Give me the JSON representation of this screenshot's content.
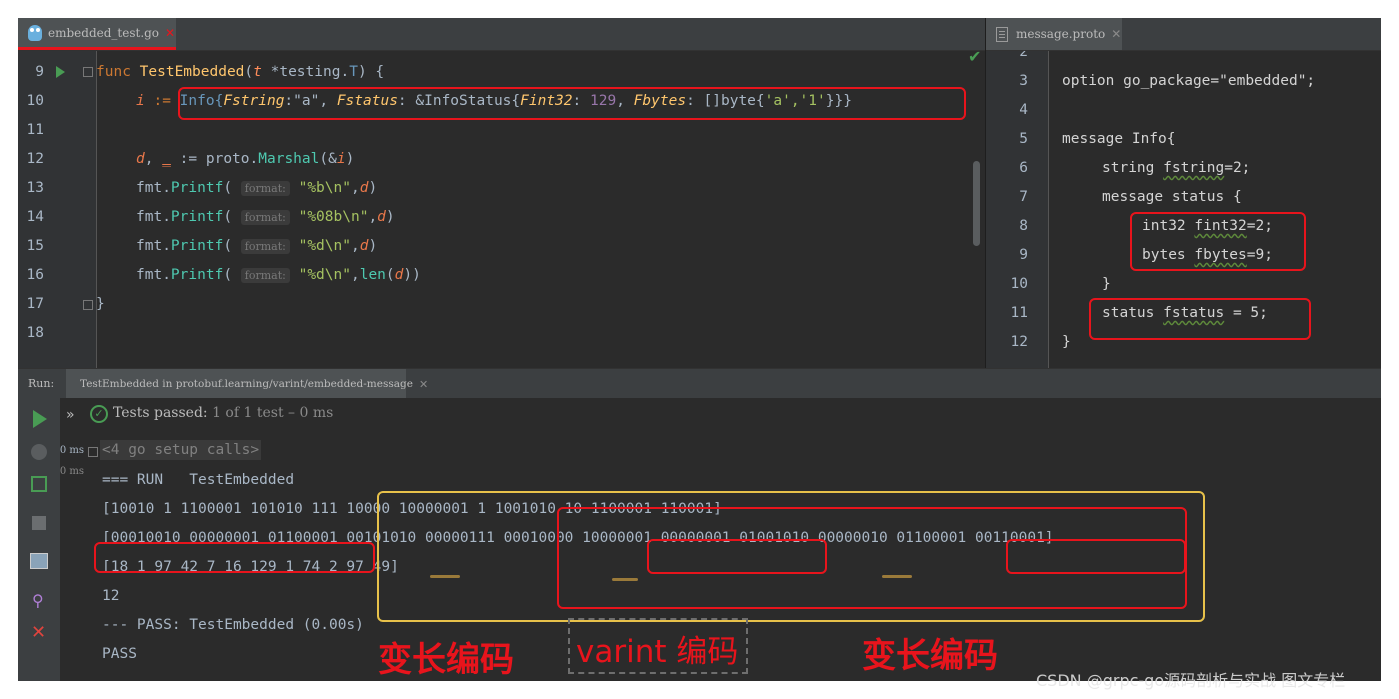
{
  "editor_left": {
    "tab_label": "embedded_test.go",
    "tab_icon": "gopher-icon",
    "lines": [
      "9",
      "10",
      "11",
      "12",
      "13",
      "14",
      "15",
      "16",
      "17",
      "18"
    ],
    "code": {
      "l9_func": "func",
      "l9_name": "TestEmbedded",
      "l9_param": "t",
      "l9_rest": " *testing.",
      "l9_T": "T",
      "l9_end": ") {",
      "l10_i": "i",
      "l10_assign": " := ",
      "l10_info": "Info{",
      "l10_fstring": "Fstring",
      "l10_a": ":\"a\", ",
      "l10_fstatus": "Fstatus",
      "l10_infostatus": ": &InfoStatus{",
      "l10_fint32": "Fint32",
      "l10_129pre": ": ",
      "l10_129": "129",
      "l10_comma": ", ",
      "l10_fbytes": "Fbytes",
      "l10_bytes": ": []byte{",
      "l10_chars": "'a','1'",
      "l10_end": "}}}",
      "l12_d": "d",
      "l12_comma": ", ",
      "l12_us": "_",
      "l12_assign": " := proto.",
      "l12_marshal": "Marshal",
      "l12_amp": "(&",
      "l12_i": "i",
      "l12_end": ")",
      "fmt": "fmt.",
      "printf": "Printf",
      "paren": "( ",
      "hint": "format:",
      "l13_fmt": "\"%b\\n\"",
      "l14_fmt": "\"%08b\\n\"",
      "l15_fmt": "\"%d\\n\"",
      "l16_fmt": "\"%d\\n\"",
      "comma": ",",
      "d": "d",
      "close": ")",
      "len": "len",
      "l16_end": "))",
      "l17": "}"
    }
  },
  "editor_right": {
    "tab_label": "message.proto",
    "lines": [
      "2",
      "3",
      "4",
      "5",
      "6",
      "7",
      "8",
      "9",
      "10",
      "11",
      "12"
    ],
    "code": {
      "l3": "option go_package=\"embedded\";",
      "l5": "message Info{",
      "l6_a": "string ",
      "l6_b": "fstring",
      "l6_c": "=2;",
      "l7": "message status {",
      "l8_a": "int32 ",
      "l8_b": "fint32",
      "l8_c": "=2;",
      "l9_a": "bytes ",
      "l9_b": "fbytes",
      "l9_c": "=9;",
      "l10": "}",
      "l11_a": "status ",
      "l11_b": "fstatus",
      "l11_c": " = 5;",
      "l12": "}"
    }
  },
  "run": {
    "label": "Run:",
    "tab": "TestEmbedded in protobuf.learning/varint/embedded-message",
    "tests_passed": "Tests passed:",
    "count": " 1 of 1 test – 0 ms",
    "side_ms1": "0 ms",
    "side_ms2": "0 ms",
    "chevron": "»"
  },
  "console": {
    "setup": "<4 go setup calls>",
    "run": "=== RUN   TestEmbedded",
    "binary": "[10010 1 1100001 101010 111 10000 10000001 1 1001010 10 1100001 110001]",
    "padded": "[00010010 00000001 01100001 00101010 00000111 00010000 10000001 00000001 01001010 00000010 01100001 00110001]",
    "decimal": "[18 1 97 42 7 16 129 1 74 2 97 49]",
    "len": "12",
    "pass_line": "--- PASS: TestEmbedded (0.00s)",
    "pass": "PASS"
  },
  "annotations": {
    "left": "变长编码",
    "middle": "varint 编码",
    "right": "变长编码"
  },
  "watermark": "CSDN @grpc-go源码剖析与实战 图文专栏",
  "colors": {
    "highlight_red": "#e8141c",
    "highlight_yellow": "#e7c14a",
    "pass_green": "#499c54"
  }
}
